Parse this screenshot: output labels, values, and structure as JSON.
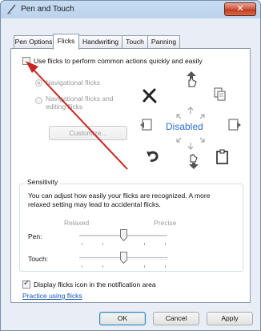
{
  "window": {
    "title": "Pen and Touch",
    "close_glyph": "✕"
  },
  "tabs": [
    {
      "label": "Pen Options"
    },
    {
      "label": "Flicks"
    },
    {
      "label": "Handwriting"
    },
    {
      "label": "Touch"
    },
    {
      "label": "Panning"
    }
  ],
  "flicks": {
    "use_flicks_label": "Use flicks to perform common actions quickly and easily",
    "use_flicks_checked": false,
    "nav_label": "Navigational flicks",
    "nav_edit_label_1": "Navigational flicks and",
    "nav_edit_label_2": "editing flicks",
    "customize_label": "Customize...",
    "status_text": "Disabled",
    "icons": [
      "delete-icon",
      "scroll-up-icon",
      "copy-icon",
      "back-icon",
      "paste-icon",
      "forward-icon",
      "undo-icon",
      "scroll-down-icon",
      "clipboard-icon"
    ]
  },
  "sensitivity": {
    "group_label": "Sensitivity",
    "description_1": "You can adjust how easily your flicks are recognized. A more",
    "description_2": "relaxed setting may lead to accidental flicks.",
    "left_label": "Relaxed",
    "right_label": "Precise",
    "pen_label": "Pen:",
    "touch_label": "Touch:",
    "pen_level": 0.5,
    "touch_level": 0.5
  },
  "notification": {
    "label": "Display flicks icon in the notification area",
    "checked": true
  },
  "practice_link": "Practice using flicks",
  "buttons": {
    "ok": "OK",
    "cancel": "Cancel",
    "apply": "Apply"
  },
  "colors": {
    "status_blue": "#2a6fd3",
    "arrow_red": "#c8261e"
  }
}
